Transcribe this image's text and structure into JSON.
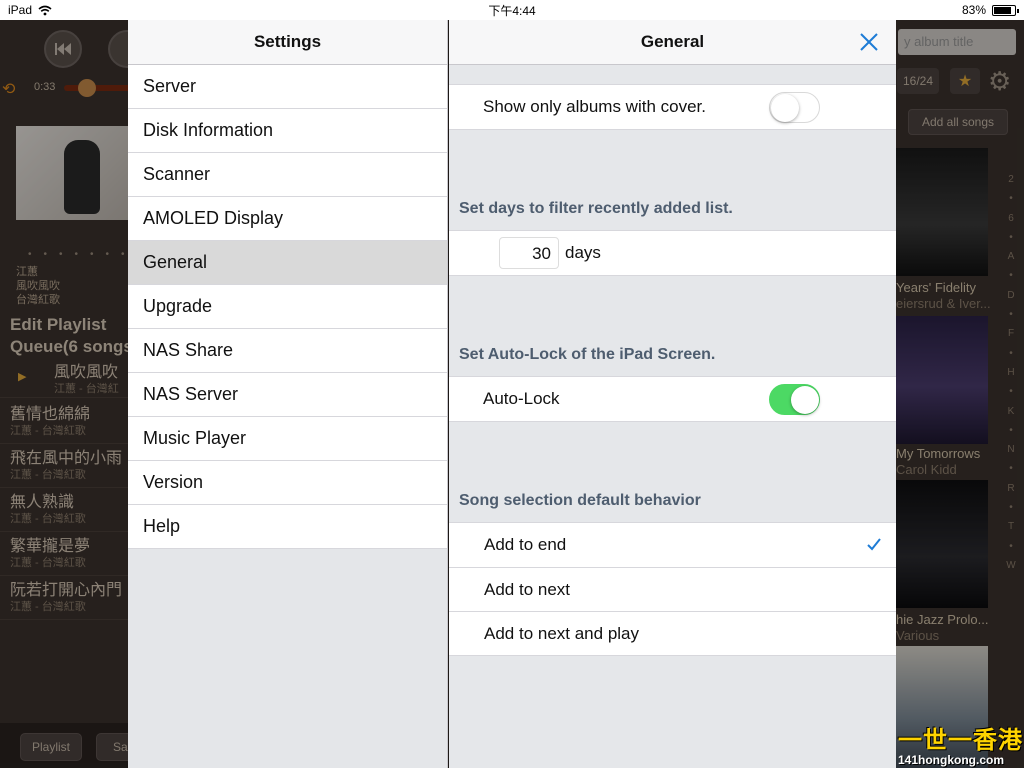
{
  "status_bar": {
    "device": "iPad",
    "time": "下午4:44",
    "battery": "83%",
    "battery_level": 0.83
  },
  "background_app": {
    "elapsed_time": "0:33",
    "album_meta": [
      "江蕙",
      "風吹風吹",
      "台灣紅歌"
    ],
    "edit_playlist": "Edit Playlist",
    "queue_label": "Queue(6 songs",
    "queue": [
      {
        "title": "風吹風吹",
        "subtitle": "江蕙 - 台灣紅",
        "playing": true
      },
      {
        "title": "舊情也綿綿",
        "subtitle": "江蕙 - 台灣紅歌"
      },
      {
        "title": "飛在風中的小雨",
        "subtitle": "江蕙 - 台灣紅歌"
      },
      {
        "title": "無人熟識",
        "subtitle": "江蕙 - 台灣紅歌"
      },
      {
        "title": "繁華攏是夢",
        "subtitle": "江蕙 - 台灣紅歌"
      },
      {
        "title": "阮若打開心內門",
        "subtitle": "江蕙 - 台灣紅歌"
      }
    ],
    "bottom_buttons": [
      "Playlist",
      "Sa"
    ],
    "search_placeholder": "y album title",
    "page_indicator": "16/24",
    "add_all_label": "Add all songs",
    "albums": [
      {
        "title": "Years' Fidelity",
        "artist": "eiersrud & Iver..."
      },
      {
        "title": "My Tomorrows",
        "artist": "Carol Kidd"
      },
      {
        "title": "hie Jazz Prolo...",
        "artist": "Various"
      }
    ],
    "index_letters": [
      "2",
      "•",
      "6",
      "•",
      "A",
      "•",
      "D",
      "•",
      "F",
      "•",
      "H",
      "•",
      "K",
      "•",
      "N",
      "•",
      "R",
      "•",
      "T",
      "•",
      "W"
    ]
  },
  "watermark": {
    "line1": "一世一香港",
    "line2": "141hongkong.com"
  },
  "master": {
    "title": "Settings",
    "items": [
      {
        "label": "Server"
      },
      {
        "label": "Disk Information"
      },
      {
        "label": "Scanner"
      },
      {
        "label": "AMOLED Display"
      },
      {
        "label": "General",
        "selected": true
      },
      {
        "label": "Upgrade"
      },
      {
        "label": "NAS Share"
      },
      {
        "label": "NAS Server"
      },
      {
        "label": "Music Player"
      },
      {
        "label": "Version"
      },
      {
        "label": "Help"
      }
    ]
  },
  "detail": {
    "title": "General",
    "show_albums_with_cover": {
      "label": "Show only albums with cover.",
      "on": false
    },
    "recent_section": {
      "header": "Set days to filter recently added list.",
      "days_value": "30",
      "days_unit": "days"
    },
    "autolock_section": {
      "header": "Set Auto-Lock of the iPad Screen.",
      "label": "Auto-Lock",
      "on": true
    },
    "song_selection": {
      "header": "Song selection default behavior",
      "options": [
        {
          "label": "Add to end",
          "checked": true
        },
        {
          "label": "Add to next",
          "checked": false
        },
        {
          "label": "Add to next and play",
          "checked": false
        }
      ]
    }
  },
  "colors": {
    "accent_blue": "#1e7cd6",
    "toggle_on": "#4cd964",
    "section_header": "#4e5d6f"
  }
}
